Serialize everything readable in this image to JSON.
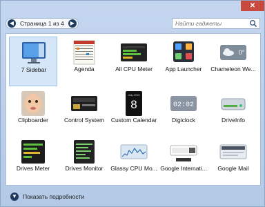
{
  "window": {
    "close_glyph": "✕"
  },
  "toolbar": {
    "page_label": "Страница 1 из 4",
    "search_placeholder": "Найти гаджеты"
  },
  "gadgets": [
    {
      "label": "7 Sidebar",
      "icon": "sidebar-monitor-icon",
      "selected": true
    },
    {
      "label": "Agenda",
      "icon": "calendar-grid-icon"
    },
    {
      "label": "All CPU Meter",
      "icon": "cpu-meter-icon"
    },
    {
      "label": "App Launcher",
      "icon": "app-launcher-icon"
    },
    {
      "label": "Chameleon We...",
      "icon": "weather-icon"
    },
    {
      "label": "Clipboarder",
      "icon": "baby-face-icon"
    },
    {
      "label": "Control System",
      "icon": "clock-panel-icon"
    },
    {
      "label": "Custom Calendar",
      "icon": "calendar-page-icon"
    },
    {
      "label": "Digiclock",
      "icon": "digital-clock-icon"
    },
    {
      "label": "DriveInfo",
      "icon": "hard-drive-icon"
    },
    {
      "label": "Drives Meter",
      "icon": "drives-meter-icon"
    },
    {
      "label": "Drives Monitor",
      "icon": "drives-monitor-icon"
    },
    {
      "label": "Glassy CPU Mo...",
      "icon": "cpu-graph-icon"
    },
    {
      "label": "Google Internati...",
      "icon": "google-search-icon"
    },
    {
      "label": "Google Mail",
      "icon": "mail-icon"
    }
  ],
  "thumb_text": {
    "calendar_date": "8",
    "calendar_month": "July 2016",
    "clock_time": "02:02",
    "weather_temp": "0°"
  },
  "footer": {
    "details_label": "Показать подробности"
  }
}
